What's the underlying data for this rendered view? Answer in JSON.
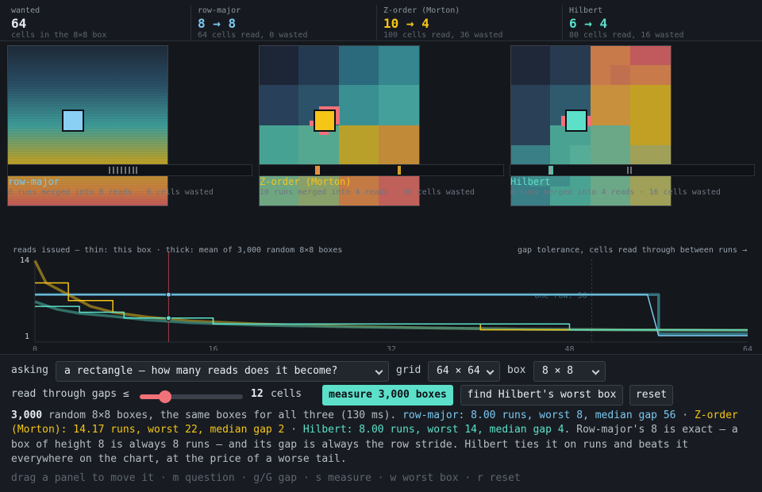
{
  "colors": {
    "row_major": "#7cc8f0",
    "z_order": "#f5c518",
    "hilbert": "#5ce0c9",
    "highlight": "#f07178",
    "muted": "#6e7681"
  },
  "stats": [
    {
      "label": "wanted",
      "value": "64",
      "sub": "cells in the 8×8 box",
      "color": "#e6edf3"
    },
    {
      "label": "row-major",
      "value": "8 → 8",
      "sub": "64 cells read, 0 wasted",
      "color": "#7cc8f0"
    },
    {
      "label": "Z-order (Morton)",
      "value": "10 → 4",
      "sub": "100 cells read, 36 wasted",
      "color": "#f5c518"
    },
    {
      "label": "Hilbert",
      "value": "6 → 4",
      "sub": "80 cells read, 16 wasted",
      "color": "#5ce0c9"
    }
  ],
  "panels": [
    {
      "title": "row-major",
      "sub": "8 runs merged into 8 reads · 0 cells wasted",
      "color": "#7cc8f0"
    },
    {
      "title": "Z-order (Morton)",
      "sub": "10 runs merged into 4 reads · 36 cells wasted",
      "color": "#f5c518"
    },
    {
      "title": "Hilbert",
      "sub": "6 runs merged into 4 reads · 16 cells wasted",
      "color": "#5ce0c9"
    }
  ],
  "chart": {
    "caption_left": "reads issued — thin: this box · thick: mean of 3,000 random 8×8 boxes",
    "caption_right": "gap tolerance, cells read through between runs →",
    "annotation": "one row: 56",
    "y_ticks": [
      "14",
      "1"
    ],
    "x_ticks": [
      "0",
      "16",
      "32",
      "48",
      "64"
    ]
  },
  "chart_data": {
    "type": "line",
    "xlabel": "gap tolerance, cells read through between runs →",
    "ylabel": "reads issued — thin: this box · thick: mean of 3,000 random 8×8 boxes",
    "xlim": [
      0,
      64
    ],
    "ylim": [
      1,
      14
    ],
    "marker_x": 12,
    "series": [
      {
        "key": "row_major_mean",
        "color": "#3f8f9e",
        "width": 3.5,
        "points": [
          [
            0,
            8
          ],
          [
            56,
            8
          ],
          [
            56,
            1.3
          ],
          [
            64,
            1.3
          ]
        ]
      },
      {
        "key": "z_mean",
        "color": "#a88a1e",
        "width": 3.5,
        "points": [
          [
            0,
            13.8
          ],
          [
            1,
            10
          ],
          [
            3,
            8
          ],
          [
            5,
            6
          ],
          [
            7,
            5
          ],
          [
            10,
            4.2
          ],
          [
            14,
            3.5
          ],
          [
            20,
            3
          ],
          [
            28,
            2.6
          ],
          [
            36,
            2.3
          ],
          [
            44,
            2.1
          ],
          [
            52,
            2
          ],
          [
            64,
            1.9
          ]
        ]
      },
      {
        "key": "hilbert_mean",
        "color": "#3b8c80",
        "width": 3.5,
        "points": [
          [
            0,
            6.8
          ],
          [
            2,
            5.5
          ],
          [
            4,
            4.8
          ],
          [
            7,
            4.3
          ],
          [
            10,
            3.7
          ],
          [
            14,
            3.2
          ],
          [
            20,
            2.8
          ],
          [
            28,
            2.5
          ],
          [
            36,
            2.3
          ],
          [
            44,
            2.1
          ],
          [
            52,
            2
          ],
          [
            64,
            1.9
          ]
        ]
      },
      {
        "key": "row_major_box",
        "color": "#7cc8f0",
        "width": 1.5,
        "points": [
          [
            0,
            8
          ],
          [
            55,
            8
          ],
          [
            56,
            1
          ],
          [
            64,
            1
          ]
        ]
      },
      {
        "key": "z_box",
        "color": "#f5c518",
        "width": 1.5,
        "points": [
          [
            0,
            10
          ],
          [
            3,
            10
          ],
          [
            3,
            7
          ],
          [
            7,
            7
          ],
          [
            7,
            5
          ],
          [
            8,
            5
          ],
          [
            8,
            4
          ],
          [
            16,
            4
          ],
          [
            16,
            3
          ],
          [
            40,
            3
          ],
          [
            40,
            2
          ],
          [
            64,
            2
          ]
        ]
      },
      {
        "key": "hilbert_box",
        "color": "#5ce0c9",
        "width": 1.5,
        "points": [
          [
            0,
            6
          ],
          [
            4,
            6
          ],
          [
            4,
            5
          ],
          [
            8,
            5
          ],
          [
            8,
            4
          ],
          [
            16,
            4
          ],
          [
            16,
            3
          ],
          [
            48,
            3
          ],
          [
            48,
            2
          ],
          [
            64,
            2
          ]
        ]
      }
    ]
  },
  "controls": {
    "asking_label": "asking",
    "asking_value": "a rectangle — how many reads does it become?",
    "grid_label": "grid",
    "grid_value": "64 × 64",
    "box_label": "box",
    "box_value": "8 × 8",
    "gap_label": "read through gaps ≤",
    "gap_value": 12,
    "gap_max": 64,
    "gap_display": "12",
    "gap_unit": "cells",
    "measure_label": "measure 3,000 boxes",
    "worst_label": "find Hilbert's worst box",
    "reset_label": "reset"
  },
  "summary": {
    "count": "3,000",
    "intro": " random 8×8 boxes, the same boxes for all three (130 ms). ",
    "row": "row-major: 8.00 runs, worst 8, median gap 56",
    "sep1": " · ",
    "z": "Z-order (Morton): 14.17 runs, worst 22, median gap 2",
    "sep2": " · ",
    "h": "Hilbert: 8.00 runs, worst 14, median gap 4",
    "outro": ". Row-major's 8 is exact — a box of height 8 is always 8 runs — and its gap is always the row stride. Hilbert ties it on runs and beats it everywhere on the chart, at the price of a worse tail."
  },
  "hint": "drag a panel to move it · m question · g/G gap · s measure · w worst box · r reset"
}
